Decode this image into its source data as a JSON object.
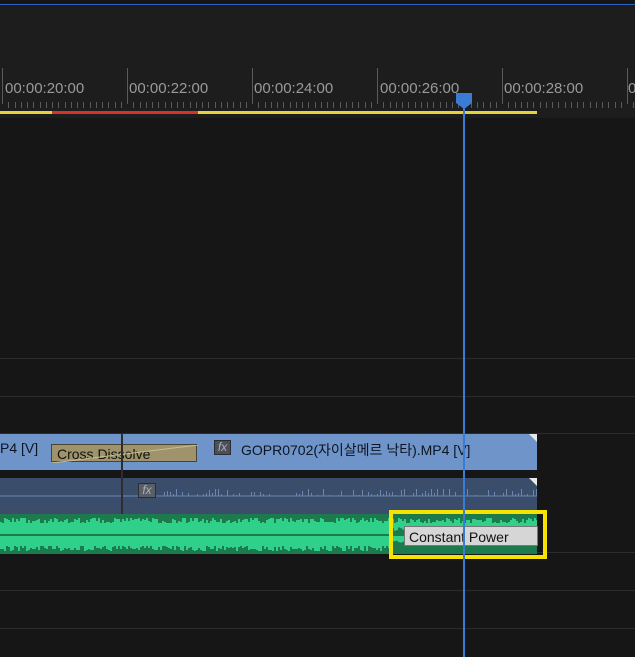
{
  "ruler": {
    "timecodes": [
      "00:00:20:00",
      "00:00:22:00",
      "00:00:24:00",
      "00:00:26:00",
      "00:00:28:00"
    ]
  },
  "video_track": {
    "clip_left_label": "P4 [V]",
    "transition_label": "Cross Dissolve",
    "fx_badge": "fx",
    "clip_title": "GOPR0702(자이살메르 낙타).MP4 [V]"
  },
  "audio_track": {
    "fx_badge": "fx",
    "transition_label": "Constant Power"
  },
  "colors": {
    "playhead": "#3a7bd5",
    "video_clip": "#6e94c9",
    "audio_clip": "#1c7a4c",
    "highlight": "#f7e300",
    "work_area": "#e6d33a",
    "render_needed": "#d4332b"
  }
}
